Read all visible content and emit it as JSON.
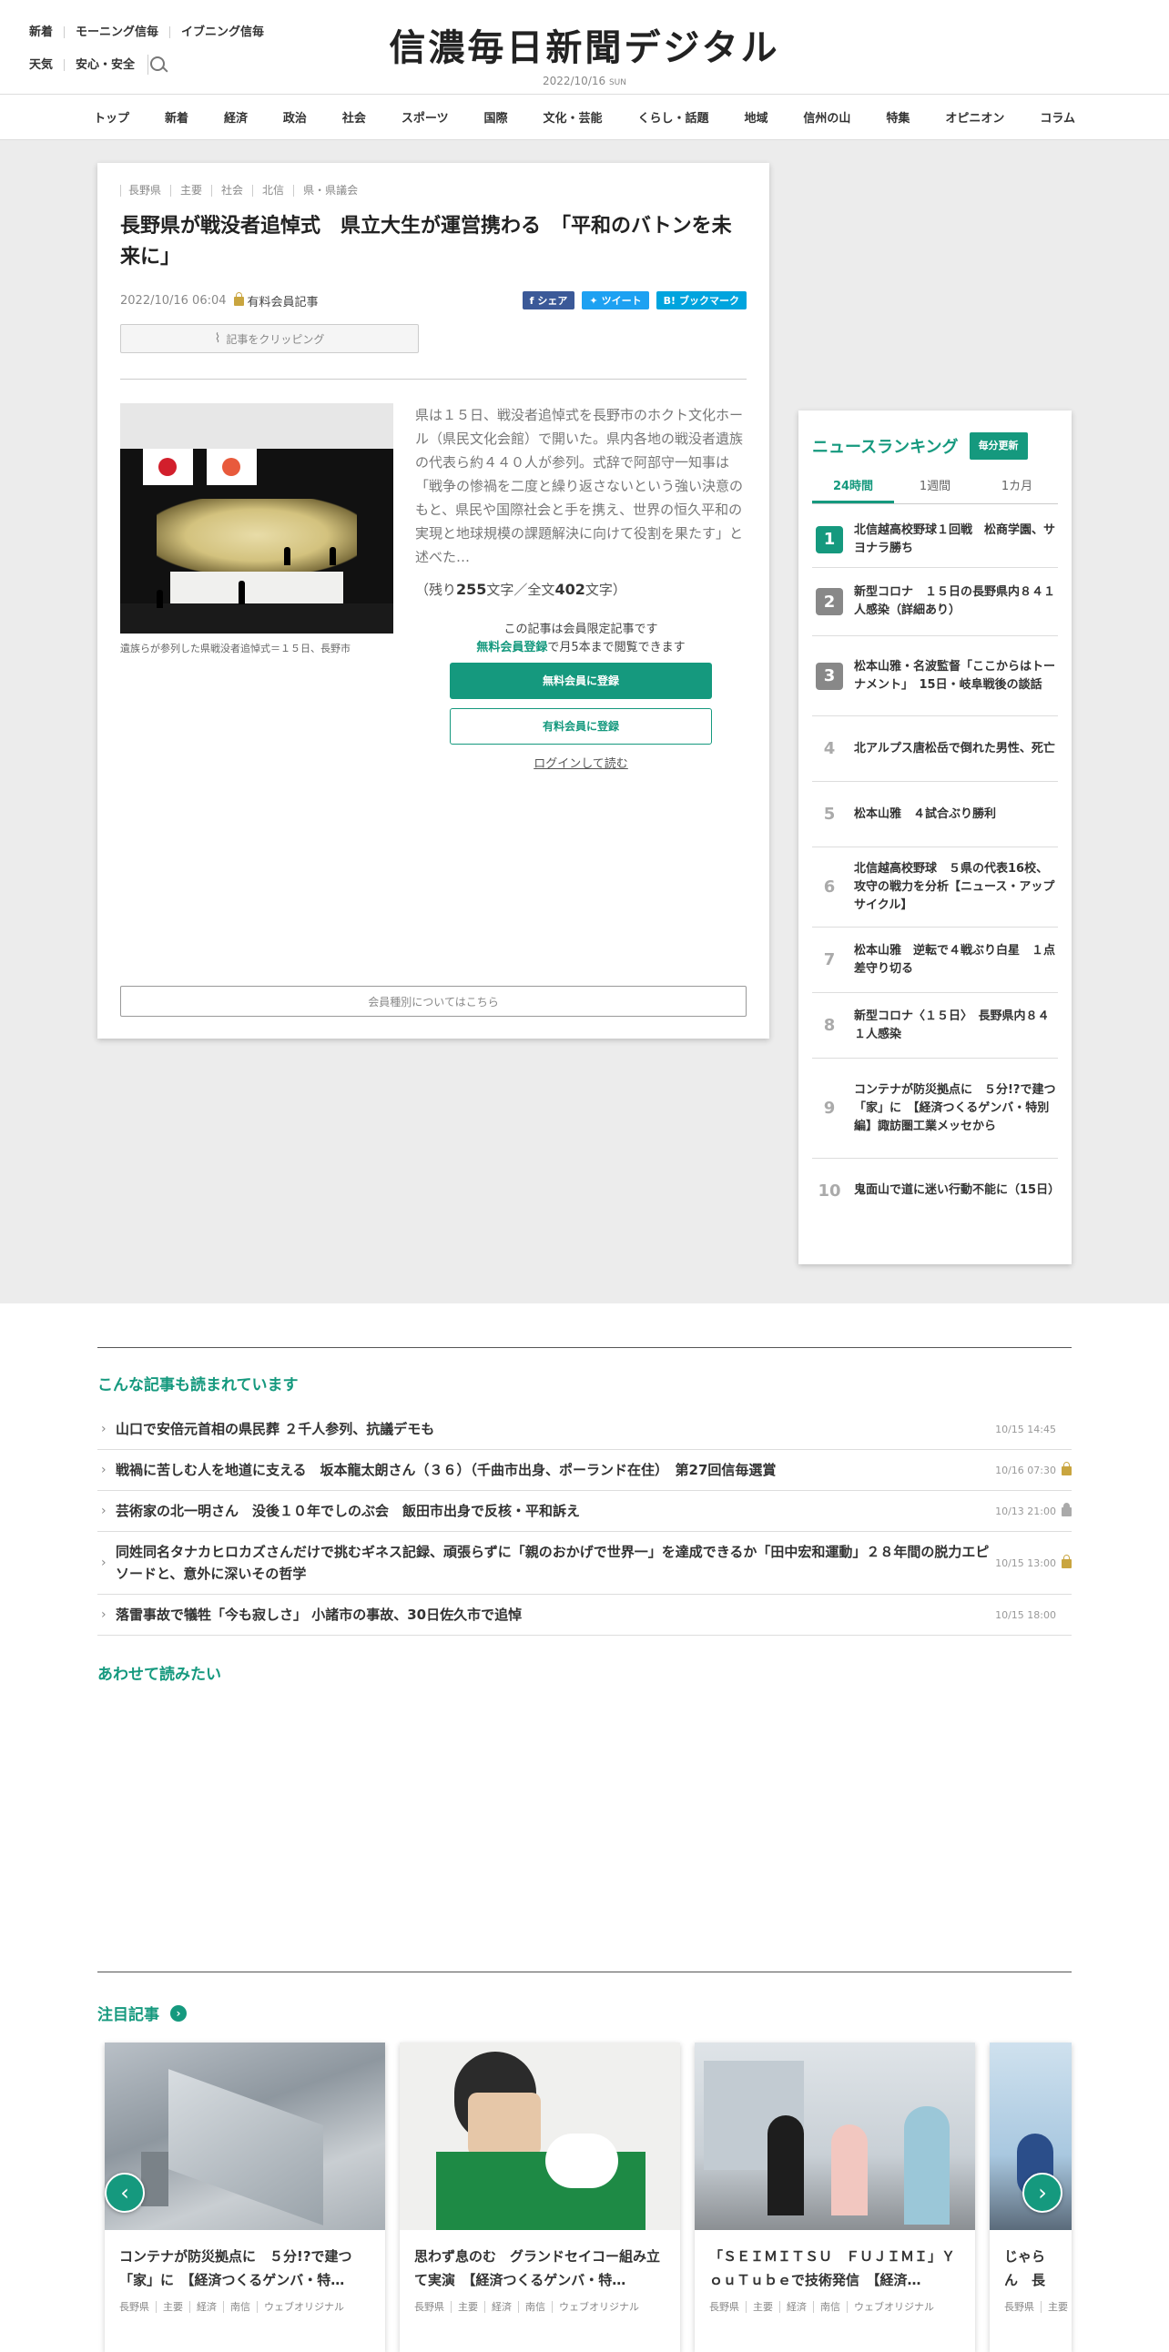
{
  "header": {
    "links_row1": [
      "新着",
      "モーニング信毎",
      "イブニング信毎"
    ],
    "links_row2": [
      "天気",
      "安心・安全"
    ],
    "logo": "信濃毎日新聞デジタル",
    "date": "2022/10/16",
    "day": "SUN"
  },
  "nav": [
    "トップ",
    "新着",
    "経済",
    "政治",
    "社会",
    "スポーツ",
    "国際",
    "文化・芸能",
    "くらし・話題",
    "地域",
    "信州の山",
    "特集",
    "オピニオン",
    "コラム"
  ],
  "article": {
    "tags": [
      "長野県",
      "主要",
      "社会",
      "北信",
      "県・県議会"
    ],
    "title": "長野県が戦没者追悼式　県立大生が運営携わる　「平和のバトンを未来に」",
    "datetime": "2022/10/16 06:04",
    "member_label": "有料会員記事",
    "share": {
      "facebook": "シェア",
      "twitter": "ツイート",
      "hatena": "ブックマーク"
    },
    "clip_label": "記事をクリッピング",
    "caption": "遺族らが参列した県戦没者追悼式＝１５日、長野市",
    "lead": "県は１５日、戦没者追悼式を長野市のホクト文化ホール（県民文化会館）で開いた。県内各地の戦没者遺族の代表ら約４４０人が参列。式辞で阿部守一知事は「戦争の惨禍を二度と繰り返さないという強い決意のもと、県民や国際社会と手を携え、世界の恒久平和の実現と地球規模の課題解決に向けて役割を果たす」と述べた…",
    "remain_prefix": "（残り",
    "remain_count": "255",
    "remain_mid": "文字／全文",
    "total_count": "402",
    "remain_suffix": "文字）",
    "cta_line1": "この記事は会員限定記事です",
    "cta_link": "無料会員登録",
    "cta_line2_rest": "で月5本まで閲覧できます",
    "btn_free": "無料会員に登録",
    "btn_paid": "有料会員に登録",
    "login": "ログインして読む",
    "member_types": "会員種別についてはこちら"
  },
  "ranking": {
    "title": "ニュースランキング",
    "badge": "毎分更新",
    "tabs": [
      "24時間",
      "1週間",
      "1カ月"
    ],
    "items": [
      {
        "rank": "1",
        "text": "北信越高校野球１回戦　松商学園、サヨナラ勝ち"
      },
      {
        "rank": "2",
        "text": "新型コロナ　１５日の長野県内８４１人感染（詳細あり）"
      },
      {
        "rank": "3",
        "text": "松本山雅・名波監督「ここからはトーナメント」　15日・岐阜戦後の談話"
      },
      {
        "rank": "4",
        "text": "北アルプス唐松岳で倒れた男性、死亡"
      },
      {
        "rank": "5",
        "text": "松本山雅　４試合ぶり勝利"
      },
      {
        "rank": "6",
        "text": "北信越高校野球　５県の代表16校、攻守の戦力を分析【ニュース・アップサイクル】"
      },
      {
        "rank": "7",
        "text": "松本山雅　逆転で４戦ぶり白星　１点差守り切る"
      },
      {
        "rank": "8",
        "text": "新型コロナ〈１５日〉　長野県内８４１人感染"
      },
      {
        "rank": "9",
        "text": "コンテナが防災拠点に　５分!?で建つ「家」に　【経済つくるゲンバ・特別編】諏訪圏工業メッセから"
      },
      {
        "rank": "10",
        "text": "鬼面山で道に迷い行動不能に（15日）"
      }
    ]
  },
  "also_read": {
    "title": "こんな記事も読まれています",
    "items": [
      {
        "text": "山口で安倍元首相の県民葬 ２千人参列、抗議デモも",
        "date": "10/15 14:45",
        "lock": ""
      },
      {
        "text": "戦禍に苦しむ人を地道に支える　坂本龍太朗さん（３６）（千曲市出身、ポーランド在住）　第27回信毎選賞",
        "date": "10/16 07:30",
        "lock": "gold"
      },
      {
        "text": "芸術家の北一明さん　没後１０年でしのぶ会　飯田市出身で反核・平和訴え",
        "date": "10/13 21:00",
        "lock": "gray"
      },
      {
        "text": "同姓同名タナカヒロカズさんだけで挑むギネス記録、頑張らずに「親のおかげで世界一」を達成できるか「田中宏和運動」２８年間の脱力エピソードと、意外に深いその哲学",
        "date": "10/15 13:00",
        "lock": "gold"
      },
      {
        "text": "落雷事故で犠牲「今も寂しさ」 小諸市の事故、30日佐久市で追悼",
        "date": "10/15 18:00",
        "lock": ""
      }
    ]
  },
  "together": {
    "title": "あわせて読みたい"
  },
  "featured": {
    "title": "注目記事",
    "cards": [
      {
        "title": "コンテナが防災拠点に　５分!?で建つ「家」に　【経済つくるゲンバ・特…",
        "tags": [
          "長野県",
          "主要",
          "経済",
          "南信",
          "ウェブオリジナル"
        ]
      },
      {
        "title": "思わず息のむ　グランドセイコー組み立て実演　【経済つくるゲンバ・特…",
        "tags": [
          "長野県",
          "主要",
          "経済",
          "南信",
          "ウェブオリジナル"
        ]
      },
      {
        "title": "「ＳＥＩＭＩＴＳＵ　ＦＵＪＩＭＩ」ＹｏｕＴｕｂｅで技術発信　【経済…",
        "tags": [
          "長野県",
          "主要",
          "経済",
          "南信",
          "ウェブオリジナル"
        ]
      },
      {
        "title": "じゃらん　長野県から",
        "tags": [
          "長野県",
          "主要"
        ]
      }
    ]
  }
}
